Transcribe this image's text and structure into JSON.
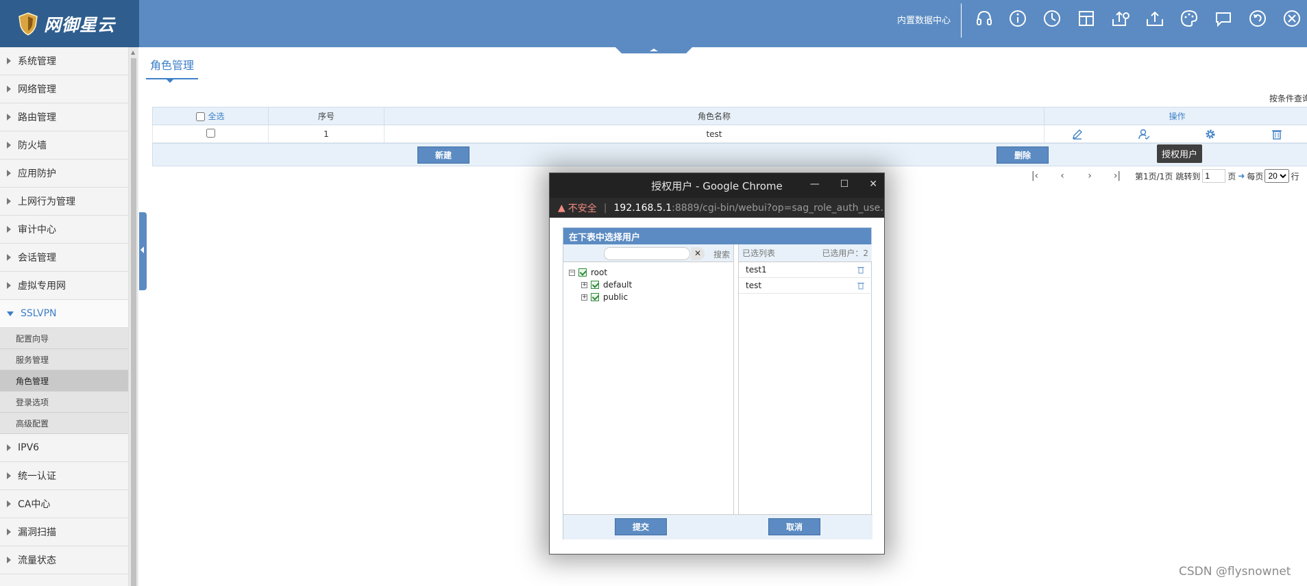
{
  "app": {
    "brand": "网御星云",
    "datacenter": "内置数据中心"
  },
  "top_icons": [
    "headset-icon",
    "info-icon",
    "clock-icon",
    "panel-icon",
    "upload-settings-icon",
    "upload-icon",
    "palette-icon",
    "chat-icon",
    "refresh-icon",
    "close-icon"
  ],
  "sidebar": {
    "items": [
      {
        "label": "系统管理"
      },
      {
        "label": "网络管理"
      },
      {
        "label": "路由管理"
      },
      {
        "label": "防火墙"
      },
      {
        "label": "应用防护"
      },
      {
        "label": "上网行为管理"
      },
      {
        "label": "审计中心"
      },
      {
        "label": "会话管理"
      },
      {
        "label": "虚拟专用网"
      },
      {
        "label": "SSLVPN"
      },
      {
        "label": "IPV6"
      },
      {
        "label": "统一认证"
      },
      {
        "label": "CA中心"
      },
      {
        "label": "漏洞扫描"
      },
      {
        "label": "流量状态"
      }
    ],
    "sub_items": [
      {
        "label": "配置向导"
      },
      {
        "label": "服务管理"
      },
      {
        "label": "角色管理"
      },
      {
        "label": "登录选项"
      },
      {
        "label": "高级配置"
      }
    ]
  },
  "main": {
    "title": "角色管理",
    "condition_query": "按条件查询",
    "table": {
      "headers": {
        "select_all": "全选",
        "seq": "序号",
        "name": "角色名称",
        "ops": "操作"
      },
      "rows": [
        {
          "seq": "1",
          "name": "test"
        }
      ]
    },
    "buttons": {
      "new": "新建",
      "delete": "删除"
    },
    "tooltip": "授权用户",
    "pager": {
      "page_info": "第1页/1页",
      "jump_to": "跳转到",
      "page_value": "1",
      "page_unit": "页",
      "per_page": "每页",
      "per_page_value": "20",
      "row_unit": "行"
    }
  },
  "popup": {
    "window_title": "授权用户 - Google Chrome",
    "insecure": "不安全",
    "url_host": "192.168.5.1",
    "url_path": ":8889/cgi-bin/webui?op=sag_role_auth_use…",
    "dialog_title": "在下表中选择用户",
    "search_label": "搜索",
    "selected_list": "已选列表",
    "selected_count": "已选用户：2",
    "tree": {
      "root": "root",
      "children": [
        "default",
        "public"
      ]
    },
    "selected_users": [
      "test1",
      "test"
    ],
    "submit": "提交",
    "cancel": "取消"
  },
  "watermark": "CSDN @flysnownet",
  "colors": {
    "header": "#5b8bc2",
    "logo_bg": "#2f5d8e",
    "accent": "#3d7fc8"
  }
}
